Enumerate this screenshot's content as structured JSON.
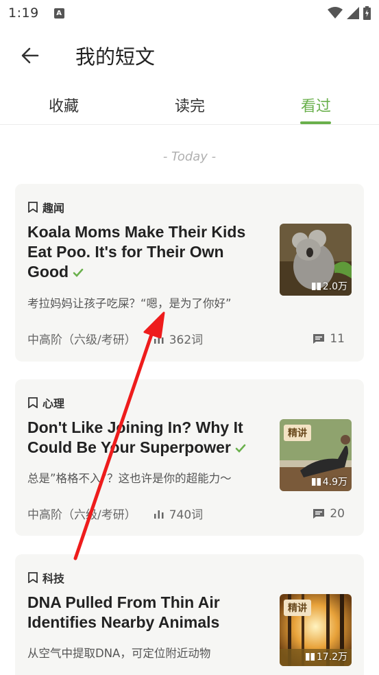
{
  "status_bar": {
    "time": "1:19",
    "notification_letter": "A"
  },
  "header": {
    "title": "我的短文"
  },
  "tabs": [
    {
      "label": "收藏"
    },
    {
      "label": "读完"
    },
    {
      "label": "看过",
      "active": true
    }
  ],
  "section": {
    "date_label": "- Today -"
  },
  "cards": [
    {
      "category": "趣闻",
      "title": "Koala Moms Make Their Kids Eat Poo. It's for Their Own Good",
      "subtitle": "考拉妈妈让孩子吃屎？“嗯，是为了你好”",
      "views": "2.0万",
      "badge": "",
      "level": "中高阶（六级/考研）",
      "words": "362词",
      "comments": "11",
      "read": true
    },
    {
      "category": "心理",
      "title": "Don't Like Joining In? Why It Could Be Your Superpower",
      "subtitle": "总是”格格不入”？这也许是你的超能力～",
      "views": "4.9万",
      "badge": "精讲",
      "level": "中高阶（六级/考研）",
      "words": "740词",
      "comments": "20",
      "read": true
    },
    {
      "category": "科技",
      "title": "DNA Pulled From Thin Air Identifies Nearby Animals",
      "subtitle": "从空气中提取DNA，可定位附近动物",
      "views": "17.2万",
      "badge": "精讲",
      "read": false
    }
  ],
  "colors": {
    "accent": "#6ab04c",
    "annotation": "#ee1c1c",
    "card_bg": "#f6f6f4"
  }
}
